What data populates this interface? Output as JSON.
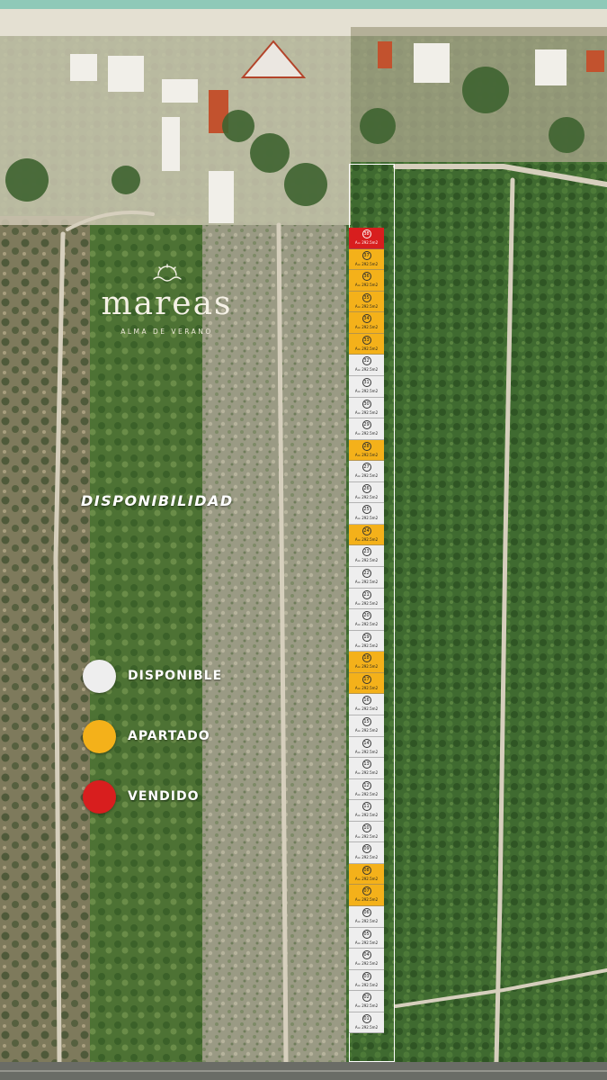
{
  "brand": {
    "name": "mareas",
    "tagline": "ALMA DE VERANO"
  },
  "section_title": "DISPONIBILIDAD",
  "status_colors": {
    "disponible": "#eeeeee",
    "apartado": "#f4b11a",
    "vendido": "#d81e1e"
  },
  "legend": [
    {
      "status": "disponible",
      "label": "DISPONIBLE"
    },
    {
      "status": "apartado",
      "label": "APARTADO"
    },
    {
      "status": "vendido",
      "label": "VENDIDO"
    }
  ],
  "lots": [
    {
      "number": "38",
      "area": "A= 292.5m2",
      "status": "vendido"
    },
    {
      "number": "37",
      "area": "A= 292.5m2",
      "status": "apartado"
    },
    {
      "number": "36",
      "area": "A= 292.5m2",
      "status": "apartado"
    },
    {
      "number": "35",
      "area": "A= 292.5m2",
      "status": "apartado"
    },
    {
      "number": "34",
      "area": "A= 292.5m2",
      "status": "apartado"
    },
    {
      "number": "33",
      "area": "A= 292.5m2",
      "status": "apartado"
    },
    {
      "number": "32",
      "area": "A= 292.5m2",
      "status": "disponible"
    },
    {
      "number": "31",
      "area": "A= 292.5m2",
      "status": "disponible"
    },
    {
      "number": "30",
      "area": "A= 292.5m2",
      "status": "disponible"
    },
    {
      "number": "29",
      "area": "A= 292.5m2",
      "status": "disponible"
    },
    {
      "number": "28",
      "area": "A= 292.5m2",
      "status": "apartado"
    },
    {
      "number": "27",
      "area": "A= 292.5m2",
      "status": "disponible"
    },
    {
      "number": "26",
      "area": "A= 292.5m2",
      "status": "disponible"
    },
    {
      "number": "25",
      "area": "A= 292.5m2",
      "status": "disponible"
    },
    {
      "number": "24",
      "area": "A= 292.5m2",
      "status": "apartado"
    },
    {
      "number": "23",
      "area": "A= 292.5m2",
      "status": "disponible"
    },
    {
      "number": "22",
      "area": "A= 292.5m2",
      "status": "disponible"
    },
    {
      "number": "21",
      "area": "A= 292.5m2",
      "status": "disponible"
    },
    {
      "number": "20",
      "area": "A= 292.5m2",
      "status": "disponible"
    },
    {
      "number": "19",
      "area": "A= 292.5m2",
      "status": "disponible"
    },
    {
      "number": "18",
      "area": "A= 292.5m2",
      "status": "apartado"
    },
    {
      "number": "17",
      "area": "A= 292.5m2",
      "status": "apartado"
    },
    {
      "number": "16",
      "area": "A= 292.5m2",
      "status": "disponible"
    },
    {
      "number": "15",
      "area": "A= 292.5m2",
      "status": "disponible"
    },
    {
      "number": "14",
      "area": "A= 292.5m2",
      "status": "disponible"
    },
    {
      "number": "13",
      "area": "A= 292.5m2",
      "status": "disponible"
    },
    {
      "number": "12",
      "area": "A= 292.5m2",
      "status": "disponible"
    },
    {
      "number": "11",
      "area": "A= 292.5m2",
      "status": "disponible"
    },
    {
      "number": "10",
      "area": "A= 292.5m2",
      "status": "disponible"
    },
    {
      "number": "09",
      "area": "A= 292.5m2",
      "status": "disponible"
    },
    {
      "number": "08",
      "area": "A= 292.5m2",
      "status": "apartado"
    },
    {
      "number": "07",
      "area": "A= 292.5m2",
      "status": "apartado"
    },
    {
      "number": "06",
      "area": "A= 292.5m2",
      "status": "disponible"
    },
    {
      "number": "05",
      "area": "A= 292.5m2",
      "status": "disponible"
    },
    {
      "number": "04",
      "area": "A= 292.5m2",
      "status": "disponible"
    },
    {
      "number": "03",
      "area": "A= 292.5m2",
      "status": "disponible"
    },
    {
      "number": "02",
      "area": "A= 292.5m2",
      "status": "disponible"
    },
    {
      "number": "01",
      "area": "A= 292.5m2",
      "status": "disponible"
    }
  ]
}
